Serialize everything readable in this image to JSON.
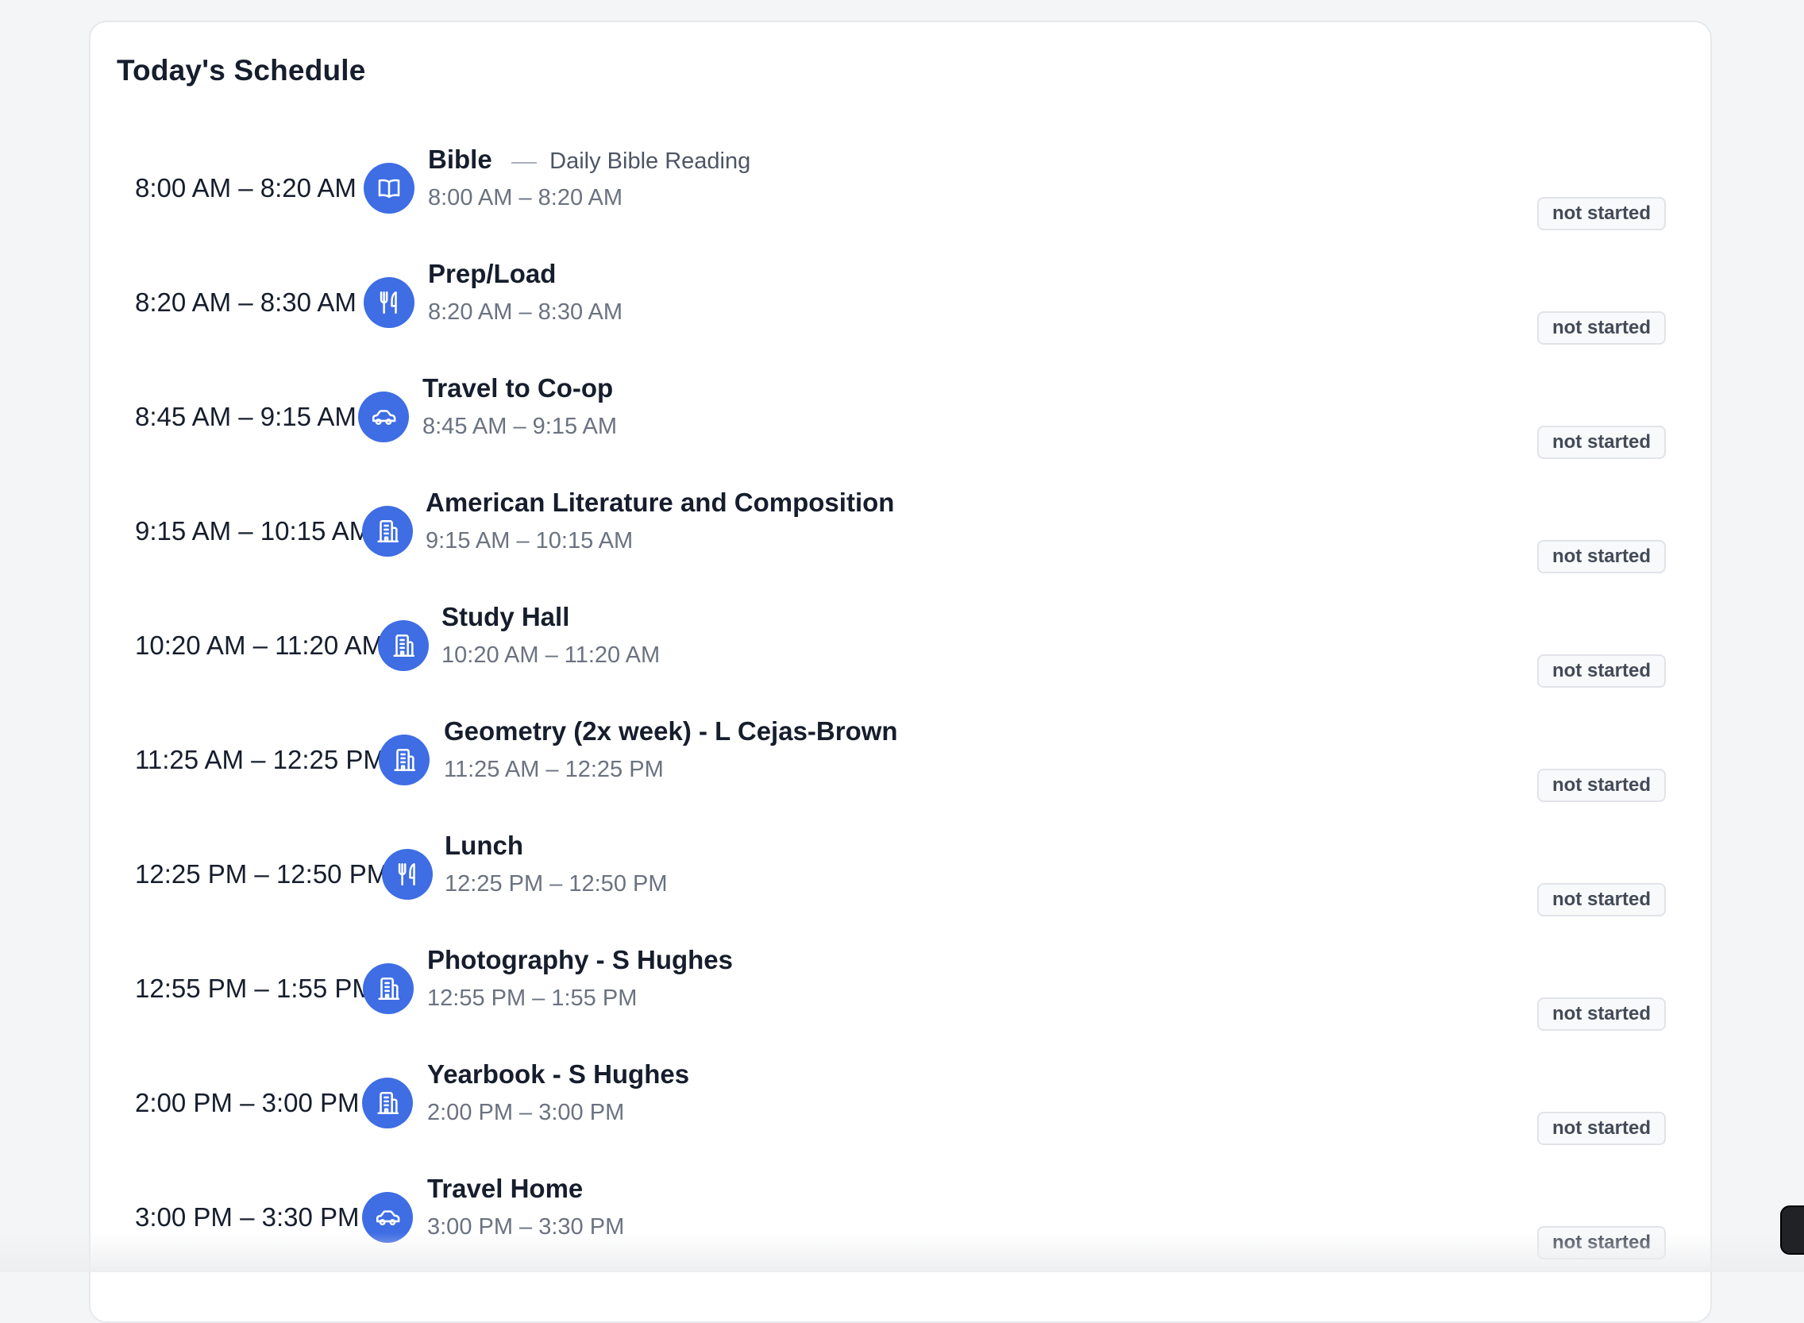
{
  "card": {
    "title": "Today's Schedule"
  },
  "schedule": [
    {
      "time_range": "8:00 AM – 8:20 AM",
      "icon": "book-open-icon",
      "title": "Bible",
      "subtitle": "Daily Bible Reading",
      "time": "8:00 AM – 8:20 AM",
      "status": "not started"
    },
    {
      "time_range": "8:20 AM – 8:30 AM",
      "icon": "utensils-icon",
      "title": "Prep/Load",
      "subtitle": "",
      "time": "8:20 AM – 8:30 AM",
      "status": "not started"
    },
    {
      "time_range": "8:45 AM – 9:15 AM",
      "icon": "car-icon",
      "title": "Travel to Co-op",
      "subtitle": "",
      "time": "8:45 AM – 9:15 AM",
      "status": "not started"
    },
    {
      "time_range": "9:15 AM – 10:15 AM",
      "icon": "building-icon",
      "title": "American Literature and Composition",
      "subtitle": "",
      "time": "9:15 AM – 10:15 AM",
      "status": "not started"
    },
    {
      "time_range": "10:20 AM – 11:20 AM",
      "icon": "building-icon",
      "title": "Study Hall",
      "subtitle": "",
      "time": "10:20 AM – 11:20 AM",
      "status": "not started"
    },
    {
      "time_range": "11:25 AM – 12:25 PM",
      "icon": "building-icon",
      "title": "Geometry (2x week) - L Cejas-Brown",
      "subtitle": "",
      "time": "11:25 AM – 12:25 PM",
      "status": "not started"
    },
    {
      "time_range": "12:25 PM – 12:50 PM",
      "icon": "utensils-icon",
      "title": "Lunch",
      "subtitle": "",
      "time": "12:25 PM – 12:50 PM",
      "status": "not started"
    },
    {
      "time_range": "12:55 PM – 1:55 PM",
      "icon": "building-icon",
      "title": "Photography - S Hughes",
      "subtitle": "",
      "time": "12:55 PM – 1:55 PM",
      "status": "not started"
    },
    {
      "time_range": "2:00 PM – 3:00 PM",
      "icon": "building-icon",
      "title": "Yearbook - S Hughes",
      "subtitle": "",
      "time": "2:00 PM – 3:00 PM",
      "status": "not started"
    },
    {
      "time_range": "3:00 PM – 3:30 PM",
      "icon": "car-icon",
      "title": "Travel Home",
      "subtitle": "",
      "time": "3:00 PM – 3:30 PM",
      "status": "not started"
    }
  ],
  "colors": {
    "accent": "#3e6de4",
    "background": "#f4f5f7",
    "card": "#ffffff",
    "text": "#161d2c",
    "muted": "#6b7280"
  }
}
